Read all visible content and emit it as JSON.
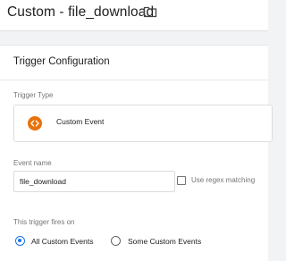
{
  "header": {
    "title": "Custom - file_download"
  },
  "trigger_config": {
    "title": "Trigger Configuration",
    "trigger_type_label": "Trigger Type",
    "trigger_type_name": "Custom Event",
    "event_name_label": "Event name",
    "event_name_value": "file_download",
    "regex_label": "Use regex matching",
    "regex_checked": false,
    "fires_on_label": "This trigger fires on",
    "fires_on_options": [
      {
        "label": "All Custom Events",
        "selected": true
      },
      {
        "label": "Some Custom Events",
        "selected": false
      }
    ]
  },
  "colors": {
    "accent": "#1a73e8",
    "custom_event_icon": "#e8710a"
  }
}
